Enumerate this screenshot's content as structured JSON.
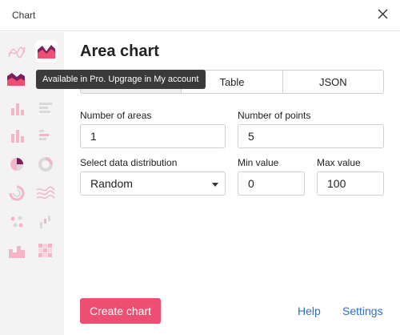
{
  "window": {
    "title": "Chart",
    "close_icon": "close-icon"
  },
  "sidebar": {
    "chart_types": [
      {
        "icon": "line-chart-icon"
      },
      {
        "icon": "area-chart-icon",
        "selected": true
      },
      {
        "icon": "stacked-area-chart-icon"
      },
      {
        "icon": "horizontal-bar-chart-icon"
      },
      {
        "icon": "column-chart-icon"
      },
      {
        "icon": "stacked-bar-chart-icon"
      },
      {
        "icon": "stacked-column-chart-icon"
      },
      {
        "icon": "diverging-bar-chart-icon"
      },
      {
        "icon": "pie-chart-icon"
      },
      {
        "icon": "donut-chart-icon"
      },
      {
        "icon": "radial-chart-icon"
      },
      {
        "icon": "stream-chart-icon"
      },
      {
        "icon": "scatter-chart-icon"
      },
      {
        "icon": "waterfall-chart-icon"
      },
      {
        "icon": "histogram-icon"
      },
      {
        "icon": "heatmap-icon"
      }
    ]
  },
  "tooltip": {
    "text": "Available in Pro. Upgrage in My account"
  },
  "main": {
    "heading": "Area chart",
    "tabs": [
      {
        "label": ""
      },
      {
        "label": "Table"
      },
      {
        "label": "JSON"
      }
    ],
    "form": {
      "areas_label": "Number of areas",
      "areas_value": "1",
      "points_label": "Number of points",
      "points_value": "5",
      "distribution_label": "Select data distribution",
      "distribution_value": "Random",
      "min_label": "Min value",
      "min_value": "0",
      "max_label": "Max value",
      "max_value": "100"
    }
  },
  "footer": {
    "create_label": "Create chart",
    "help_label": "Help",
    "settings_label": "Settings"
  },
  "colors": {
    "accent": "#ef4e73",
    "icon_pink": "#f4b6c6",
    "icon_dark": "#7b1f5e",
    "link": "#2f6fc7"
  }
}
